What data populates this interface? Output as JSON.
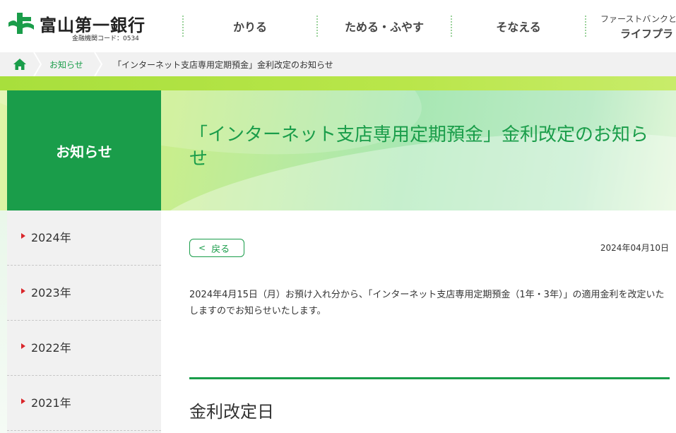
{
  "header": {
    "logo_name": "富山第一銀行",
    "logo_code": "金融機関コード：0534",
    "nav": [
      {
        "label": "かりる"
      },
      {
        "label": "ためる・ふやす"
      },
      {
        "label": "そなえる"
      }
    ],
    "nav_extra_line1": "ファーストバンクと",
    "nav_extra_line2": "ライフプラ"
  },
  "breadcrumb": {
    "home_icon": "home-icon",
    "link": "お知らせ",
    "current": "「インターネット支店専用定期預金」金利改定のお知らせ"
  },
  "sidebar": {
    "title": "お知らせ",
    "years": [
      {
        "label": "2024年"
      },
      {
        "label": "2023年"
      },
      {
        "label": "2022年"
      },
      {
        "label": "2021年"
      }
    ]
  },
  "main": {
    "title": "「インターネット支店専用定期預金」金利改定のお知らせ",
    "back_label": "戻る",
    "date": "2024年04月10日",
    "body": "2024年4月15日（月）お預け入れ分から、「インターネット支店専用定期預金（1年・3年）」の適用金利を改定いたしますのでお知らせいたします。",
    "section_title": "金利改定日"
  },
  "colors": {
    "brand_green": "#1a9d4a",
    "accent_red": "#d9262b",
    "band_lime": "#b9e64a"
  }
}
